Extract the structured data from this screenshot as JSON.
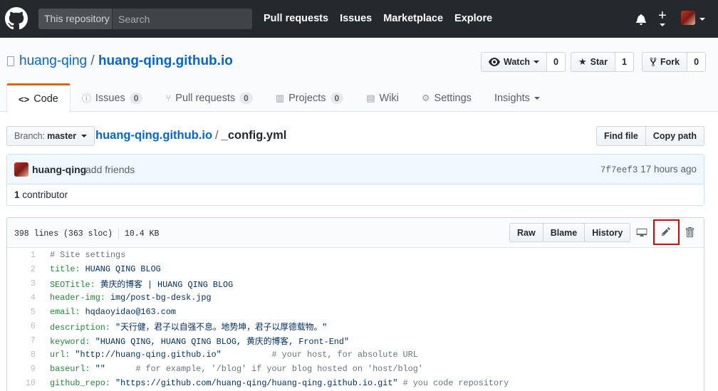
{
  "header": {
    "search_scope": "This repository",
    "search_placeholder": "Search",
    "nav": [
      "Pull requests",
      "Issues",
      "Marketplace",
      "Explore"
    ]
  },
  "repo": {
    "owner": "huang-qing",
    "separator": "/",
    "name": "huang-qing.github.io",
    "watch_label": "Watch",
    "watch_count": "0",
    "star_label": "Star",
    "star_count": "1",
    "fork_label": "Fork",
    "fork_count": "0"
  },
  "tabs": {
    "code": "Code",
    "issues": "Issues",
    "issues_count": "0",
    "pulls": "Pull requests",
    "pulls_count": "0",
    "projects": "Projects",
    "projects_count": "0",
    "wiki": "Wiki",
    "settings": "Settings",
    "insights": "Insights"
  },
  "filenav": {
    "branch_prefix": "Branch:",
    "branch": "master",
    "root": "huang-qing.github.io",
    "sep": "/",
    "file": "_config.yml",
    "find_file": "Find file",
    "copy_path": "Copy path"
  },
  "commit": {
    "author": "huang-qing",
    "message": "add friends",
    "sha": "7f7eef3",
    "time": "17 hours ago",
    "contributors_count": "1",
    "contributors_label": "contributor"
  },
  "file": {
    "lines_info": "398 lines (363 sloc)",
    "size": "10.4 KB",
    "raw": "Raw",
    "blame": "Blame",
    "history": "History"
  },
  "code_lines": [
    {
      "n": "1",
      "key": "",
      "val": "",
      "comment": "# Site settings"
    },
    {
      "n": "2",
      "key": "title:",
      "val": " HUANG QING BLOG",
      "comment": ""
    },
    {
      "n": "3",
      "key": "SEOTitle:",
      "val": " 黄庆的博客 | HUANG QING BLOG",
      "comment": ""
    },
    {
      "n": "4",
      "key": "header-img:",
      "val": " img/post-bg-desk.jpg",
      "comment": ""
    },
    {
      "n": "5",
      "key": "email:",
      "val": " hqdaoyidao@163.com",
      "comment": ""
    },
    {
      "n": "6",
      "key": "description:",
      "val": " \"天行健，君子以自强不息。地势坤，君子以厚德载物。\"",
      "comment": ""
    },
    {
      "n": "7",
      "key": "keyword:",
      "val": " \"HUANG QING, HUANG QING BLOG, 黄庆的博客, Front-End\"",
      "comment": ""
    },
    {
      "n": "8",
      "key": "url:",
      "val": " \"http://huang-qing.github.io\"          ",
      "comment": "# your host, for absolute URL"
    },
    {
      "n": "9",
      "key": "baseurl:",
      "val": " \"\"      ",
      "comment": "# for example, '/blog' if your blog hosted on 'host/blog'"
    },
    {
      "n": "10",
      "key": "github_repo:",
      "val": " \"https://github.com/huang-qing/huang-qing.github.io.git\" ",
      "comment": "# you code repository"
    }
  ]
}
